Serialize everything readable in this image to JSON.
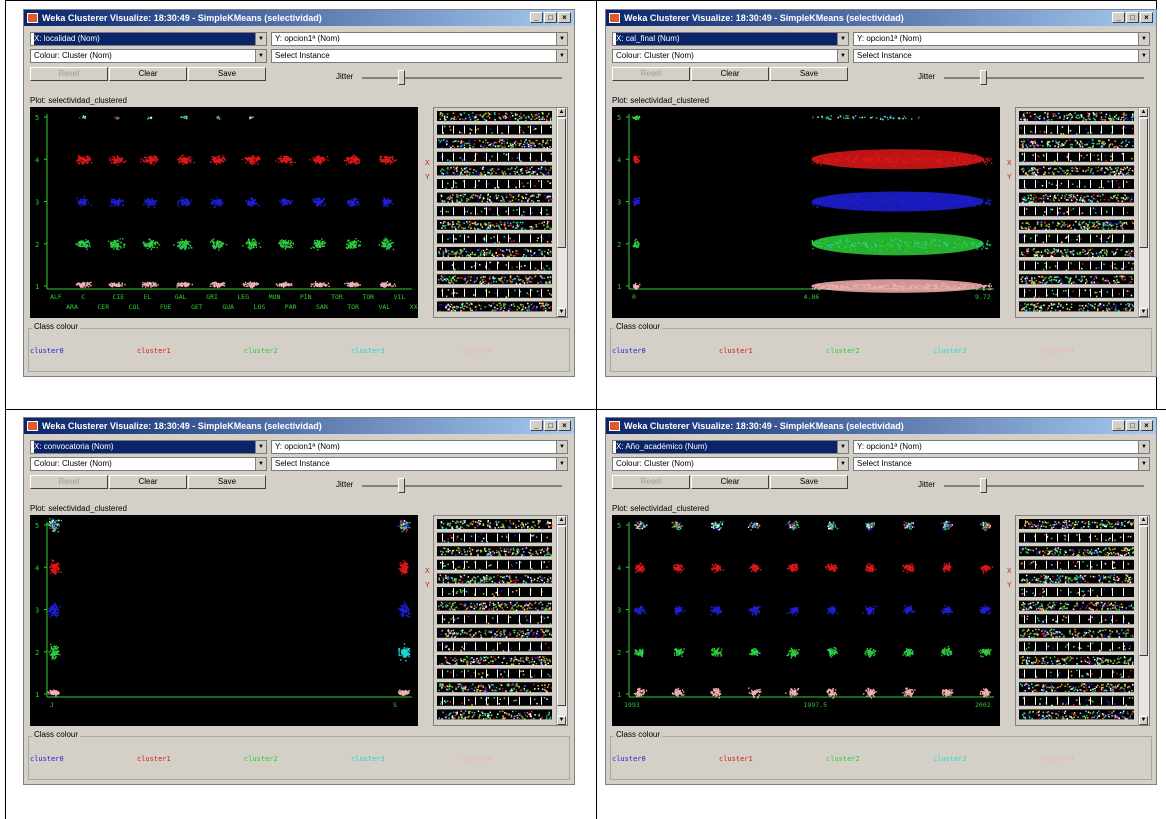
{
  "colors": {
    "cluster0": "#1f1fd6",
    "cluster1": "#e01818",
    "cluster2": "#2ecf36",
    "cluster3": "#20d8d8",
    "cluster4": "#f4b0b0",
    "titlebar": "#0a246a"
  },
  "common": {
    "colour_combo": "Colour: Cluster (Nom)",
    "y_combo": "Y: opcion1ª (Nom)",
    "select_instance": "Select Instance",
    "reset_label": "Reset",
    "clear_label": "Clear",
    "save_label": "Save",
    "jitter_label": "Jitter",
    "plot_label_1": "Plot: selectividad_clustered",
    "plot_label_2": "Plot: selectividad_clustered",
    "plot_label_3": "Plot: selectividad_clustered",
    "plot_label_4": "Plot: selectividad_clustered",
    "class_colour": "Class colour",
    "x_mark": "X",
    "y_mark": "Y",
    "minimize": "_",
    "maximize": "□",
    "close": "×",
    "legend": [
      "cluster0",
      "cluster1",
      "cluster2",
      "cluster3",
      "cluster4"
    ]
  },
  "windows": [
    {
      "title": "Weka Clusterer Visualize: 18:30:49 - SimpleKMeans (selectividad)",
      "x_combo": "X: localidad (Nom)",
      "y_ticks": [
        "5",
        "4",
        "3",
        "2",
        "1"
      ],
      "x_ticks_top": [
        "ALF",
        "C",
        "CIE",
        "EL",
        "GAL",
        "GRI",
        "LEG",
        "MON",
        "PIN",
        "TOR",
        "TOR",
        "VIL"
      ],
      "x_ticks_bottom": [
        "ARA",
        "CER",
        "COL",
        "FUE",
        "GET",
        "GUA",
        "LOS",
        "PAR",
        "SAN",
        "TOR",
        "VAL",
        "XX"
      ]
    },
    {
      "title": "Weka Clusterer Visualize: 18:30:49 - SimpleKMeans (selectividad)",
      "x_combo": "X: cal_final (Num)",
      "y_ticks": [
        "5",
        "4",
        "3",
        "2",
        "1"
      ],
      "x_ticks": [
        "0",
        "4.86",
        "9.72"
      ]
    },
    {
      "title": "Weka Clusterer Visualize: 18:30:49 - SimpleKMeans (selectividad)",
      "x_combo": "X: convocatoria (Nom)",
      "y_ticks": [
        "5",
        "4",
        "3",
        "2",
        "1"
      ],
      "x_ticks": [
        "J",
        "S"
      ]
    },
    {
      "title": "Weka Clusterer Visualize: 18:30:49 - SimpleKMeans (selectividad)",
      "x_combo": "X: Año_académico (Num)",
      "y_ticks": [
        "5",
        "4",
        "3",
        "2",
        "1"
      ],
      "x_ticks": [
        "1993",
        "1997.5",
        "2002"
      ]
    }
  ]
}
